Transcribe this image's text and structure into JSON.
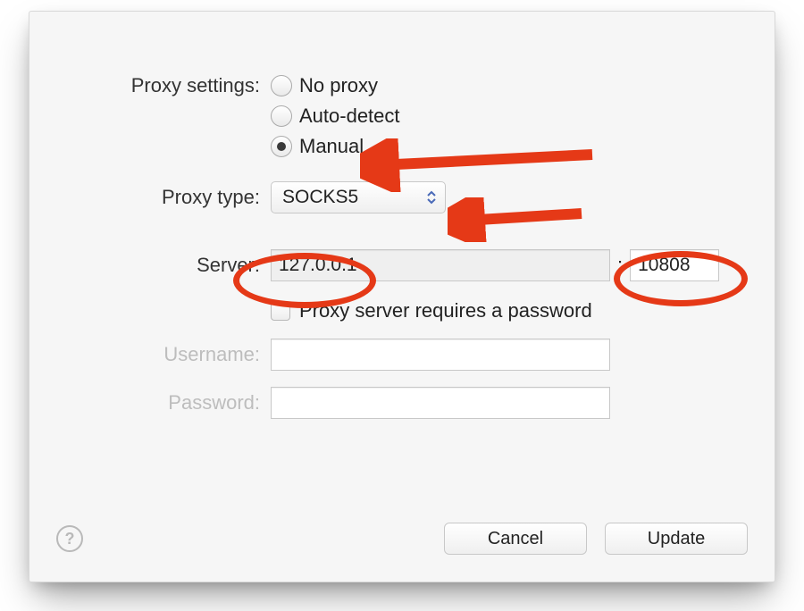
{
  "labels": {
    "proxy_settings": "Proxy settings:",
    "proxy_type": "Proxy type:",
    "server": "Server:",
    "username": "Username:",
    "password": "Password:"
  },
  "radios": {
    "no_proxy": "No proxy",
    "auto_detect": "Auto-detect",
    "manual": "Manual",
    "selected": "manual"
  },
  "proxy_type": {
    "value": "SOCKS5"
  },
  "server": {
    "host": "127.0.0.1",
    "port": "10808",
    "separator": ":"
  },
  "checkbox": {
    "label": "Proxy server requires a password",
    "checked": false
  },
  "username": {
    "value": ""
  },
  "password": {
    "value": ""
  },
  "help": {
    "glyph": "?"
  },
  "buttons": {
    "cancel": "Cancel",
    "update": "Update"
  },
  "annotation_color": "#e53917"
}
